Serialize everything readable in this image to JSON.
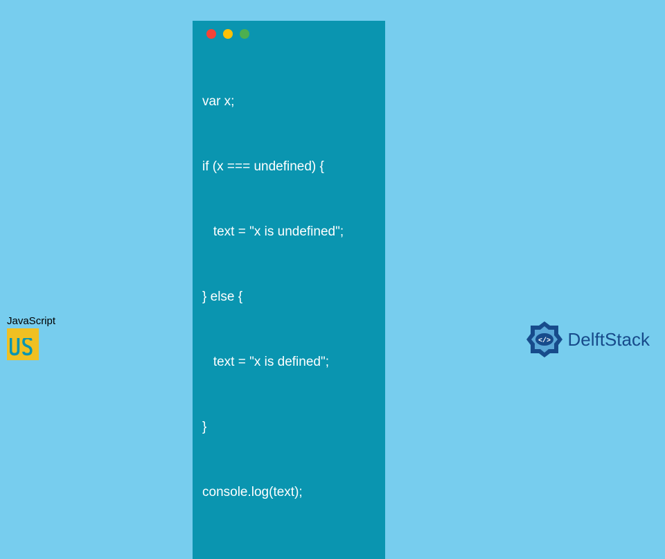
{
  "code": {
    "lines": [
      "var x;",
      "if (x === undefined) {",
      "   text = \"x is undefined\";",
      "} else {",
      "   text = \"x is defined\";",
      "}",
      "console.log(text);"
    ]
  },
  "js_badge": {
    "label": "JavaScript",
    "logo_text": "JS"
  },
  "delft": {
    "brand": "DelftStack"
  },
  "colors": {
    "page_bg": "#77cdee",
    "window_bg": "#0a95b0",
    "dot_red": "#f44336",
    "dot_yellow": "#ffc107",
    "dot_green": "#4caf50",
    "js_yellow": "#f0c022",
    "delft_blue": "#174b8b"
  }
}
